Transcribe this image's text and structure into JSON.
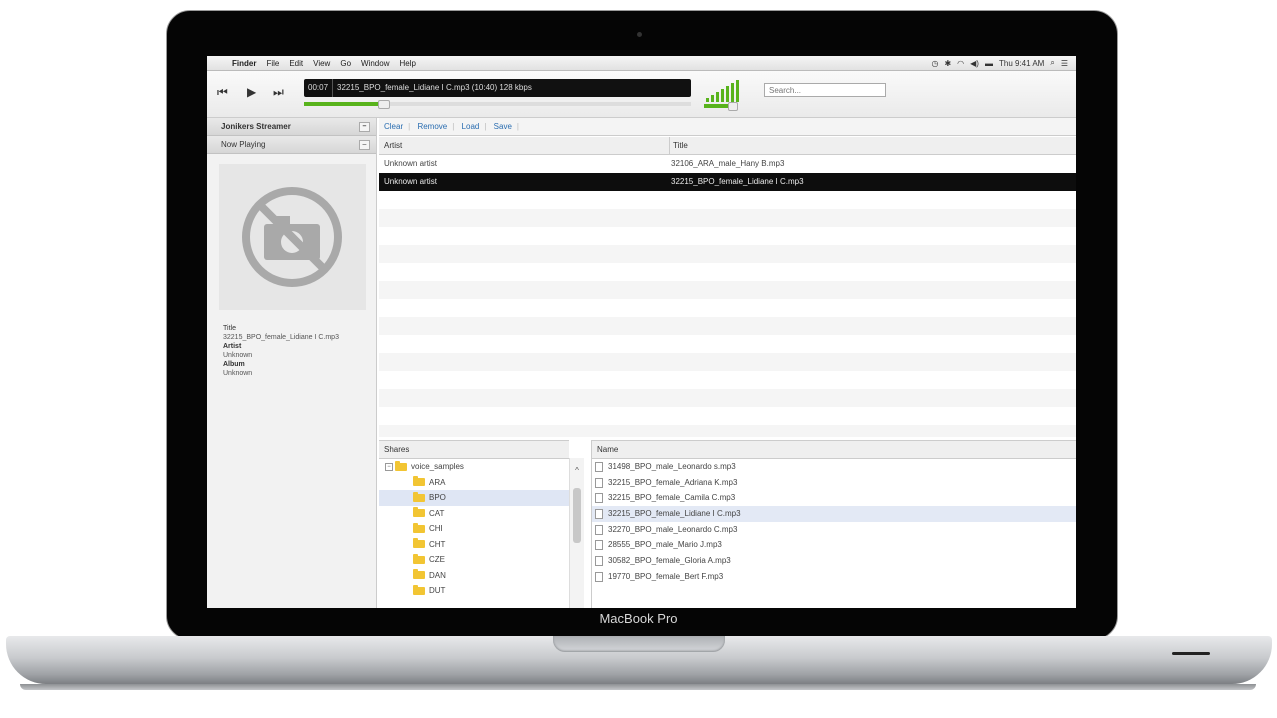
{
  "device": {
    "brand_label": "MacBook Pro"
  },
  "menubar": {
    "apple_glyph": "",
    "app_name": "Finder",
    "items": [
      "File",
      "Edit",
      "View",
      "Go",
      "Window",
      "Help"
    ],
    "clock": "Thu 9:41 AM"
  },
  "toolbar": {
    "prev_glyph": "⏮",
    "play_glyph": "▶",
    "next_glyph": "⏭",
    "elapsed": "00:07",
    "now_playing_text": "32215_BPO_female_Lidiane I C.mp3 (10:40) 128 kbps",
    "progress_fraction": 0.2,
    "volume_fraction": 0.8,
    "search_placeholder": "Search..."
  },
  "left_panel": {
    "app_title": "Jonikers Streamer",
    "now_playing_header": "Now Playing",
    "toggle_glyph": "–",
    "title_label": "Title",
    "title_value": "32215_BPO_female_Lidiane I C.mp3",
    "artist_label": "Artist",
    "artist_value": "Unknown",
    "album_label": "Album",
    "album_value": "Unknown"
  },
  "playlist": {
    "buttons": [
      "Clear",
      "Remove",
      "Load",
      "Save"
    ],
    "columns": [
      "Artist",
      "Title"
    ],
    "rows": [
      {
        "artist": "Unknown artist",
        "title": "32106_ARA_male_Hany B.mp3"
      },
      {
        "artist": "Unknown artist",
        "title": "32215_BPO_female_Lidiane I C.mp3"
      }
    ],
    "selected_row": 1,
    "empty_rows": 14
  },
  "browser": {
    "tree_header": "Shares",
    "tree": [
      {
        "label": "voice_samples",
        "level": 0
      },
      {
        "label": "ARA",
        "level": 1
      },
      {
        "label": "BPO",
        "level": 1,
        "selected": true
      },
      {
        "label": "CAT",
        "level": 1
      },
      {
        "label": "CHI",
        "level": 1
      },
      {
        "label": "CHT",
        "level": 1
      },
      {
        "label": "CZE",
        "level": 1
      },
      {
        "label": "DAN",
        "level": 1
      },
      {
        "label": "DUT",
        "level": 1
      }
    ],
    "files_header": "Name",
    "files": [
      "31498_BPO_male_Leonardo s.mp3",
      "32215_BPO_female_Adriana K.mp3",
      "32215_BPO_female_Camila C.mp3",
      "32215_BPO_female_Lidiane I C.mp3",
      "32270_BPO_male_Leonardo C.mp3",
      "28555_BPO_male_Mario J.mp3",
      "30582_BPO_female_Gloria A.mp3",
      "19770_BPO_female_Bert F.mp3"
    ],
    "selected_file": 3
  },
  "colors": {
    "accent_green": "#58b31c",
    "link_blue": "#2a6db0",
    "selection_dark": "#0d0d0d"
  }
}
